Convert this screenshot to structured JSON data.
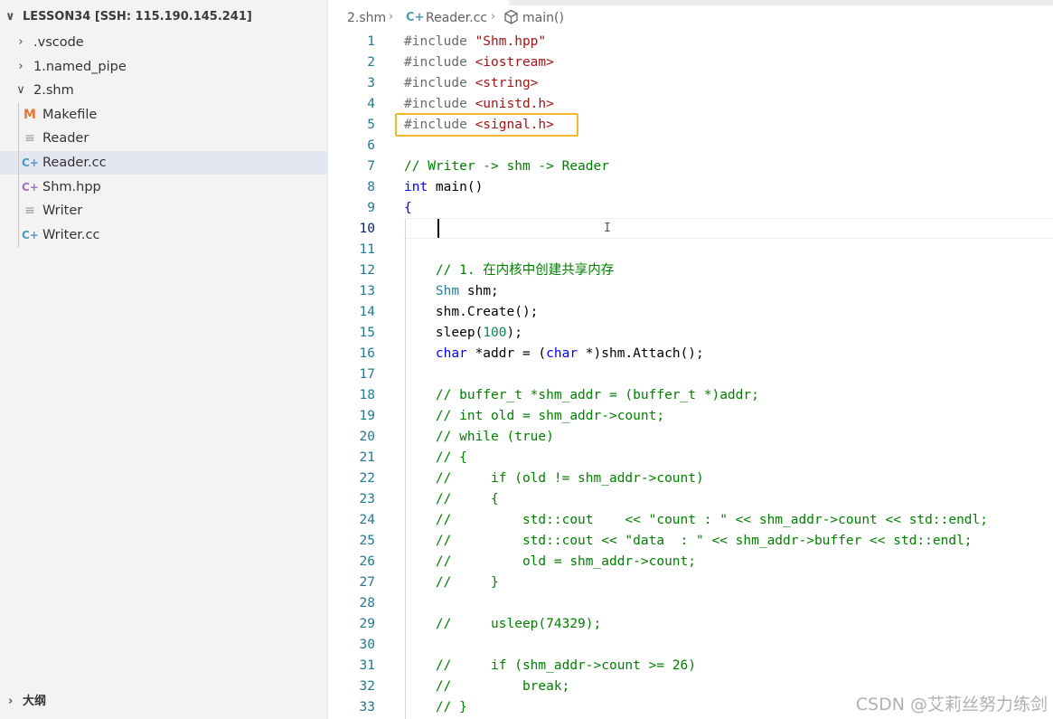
{
  "sidebar": {
    "root_label": "LESSON34 [SSH: 115.190.145.241]",
    "items": [
      {
        "label": ".vscode",
        "kind": "folder",
        "expanded": false
      },
      {
        "label": "1.named_pipe",
        "kind": "folder",
        "expanded": false
      },
      {
        "label": "2.shm",
        "kind": "folder",
        "expanded": true
      },
      {
        "label": "Makefile",
        "kind": "makefile",
        "icon": "makefile-icon",
        "icon_glyph": "M",
        "icon_color": "#e37933"
      },
      {
        "label": "Reader",
        "kind": "file",
        "icon": "plain-file-icon",
        "icon_glyph": "≡",
        "icon_color": "#9a9a9a"
      },
      {
        "label": "Reader.cc",
        "kind": "cpp",
        "icon": "cpp-file-icon",
        "icon_glyph": "C+",
        "icon_color": "#519aba",
        "selected": true
      },
      {
        "label": "Shm.hpp",
        "kind": "hpp",
        "icon": "hpp-file-icon",
        "icon_glyph": "C+",
        "icon_color": "#a074c4"
      },
      {
        "label": "Writer",
        "kind": "file",
        "icon": "plain-file-icon",
        "icon_glyph": "≡",
        "icon_color": "#9a9a9a"
      },
      {
        "label": "Writer.cc",
        "kind": "cpp",
        "icon": "cpp-file-icon",
        "icon_glyph": "C+",
        "icon_color": "#519aba"
      }
    ],
    "outline_label": "大纲"
  },
  "breadcrumb": {
    "folder": "2.shm",
    "file": "Reader.cc",
    "symbol": "main()"
  },
  "editor": {
    "line_numbers": [
      "1",
      "2",
      "3",
      "4",
      "5",
      "6",
      "7",
      "8",
      "9",
      "10",
      "11",
      "12",
      "13",
      "14",
      "15",
      "16",
      "17",
      "18",
      "19",
      "20",
      "21",
      "22",
      "23",
      "24",
      "25",
      "26",
      "27",
      "28",
      "29",
      "30",
      "31",
      "32",
      "33"
    ],
    "lines": [
      [
        {
          "t": "#include ",
          "c": "pre"
        },
        {
          "t": "\"Shm.hpp\"",
          "c": "str"
        }
      ],
      [
        {
          "t": "#include ",
          "c": "pre"
        },
        {
          "t": "<iostream>",
          "c": "str"
        }
      ],
      [
        {
          "t": "#include ",
          "c": "pre"
        },
        {
          "t": "<string>",
          "c": "str"
        }
      ],
      [
        {
          "t": "#include ",
          "c": "pre"
        },
        {
          "t": "<unistd.h>",
          "c": "str"
        }
      ],
      [
        {
          "t": "#include ",
          "c": "pre"
        },
        {
          "t": "<signal.h>",
          "c": "str"
        }
      ],
      [],
      [
        {
          "t": "// Writer -> shm -> Reader",
          "c": "com"
        }
      ],
      [
        {
          "t": "int",
          "c": "kw"
        },
        {
          "t": " main()",
          "c": "def"
        }
      ],
      [
        {
          "t": "{",
          "c": "kw"
        }
      ],
      [],
      [],
      [
        {
          "t": "    // 1. 在内核中创建共享内存",
          "c": "com"
        }
      ],
      [
        {
          "t": "    ",
          "c": "def"
        },
        {
          "t": "Shm",
          "c": "type"
        },
        {
          "t": " shm;",
          "c": "def"
        }
      ],
      [
        {
          "t": "    shm.Create();",
          "c": "def"
        }
      ],
      [
        {
          "t": "    sleep(",
          "c": "def"
        },
        {
          "t": "100",
          "c": "num"
        },
        {
          "t": ");",
          "c": "def"
        }
      ],
      [
        {
          "t": "    ",
          "c": "def"
        },
        {
          "t": "char",
          "c": "kw"
        },
        {
          "t": " *addr = (",
          "c": "def"
        },
        {
          "t": "char",
          "c": "kw"
        },
        {
          "t": " *)shm.Attach();",
          "c": "def"
        }
      ],
      [],
      [
        {
          "t": "    // buffer_t *shm_addr = (buffer_t *)addr;",
          "c": "com"
        }
      ],
      [
        {
          "t": "    // int old = shm_addr->count;",
          "c": "com"
        }
      ],
      [
        {
          "t": "    // while (true)",
          "c": "com"
        }
      ],
      [
        {
          "t": "    // {",
          "c": "com"
        }
      ],
      [
        {
          "t": "    //     if (old != shm_addr->count)",
          "c": "com"
        }
      ],
      [
        {
          "t": "    //     {",
          "c": "com"
        }
      ],
      [
        {
          "t": "    //         std::cout    << \"count : \" << shm_addr->count << std::endl;",
          "c": "com"
        }
      ],
      [
        {
          "t": "    //         std::cout << \"data  : \" << shm_addr->buffer << std::endl;",
          "c": "com"
        }
      ],
      [
        {
          "t": "    //         old = shm_addr->count;",
          "c": "com"
        }
      ],
      [
        {
          "t": "    //     }",
          "c": "com"
        }
      ],
      [],
      [
        {
          "t": "    //     usleep(74329);",
          "c": "com"
        }
      ],
      [],
      [
        {
          "t": "    //     if (shm_addr->count >= 26)",
          "c": "com"
        }
      ],
      [
        {
          "t": "    //         break;",
          "c": "com"
        }
      ],
      [
        {
          "t": "    // }",
          "c": "com"
        }
      ]
    ],
    "cursor_line": 10,
    "highlighted_line": 5
  },
  "watermark": "CSDN @艾莉丝努力练剑"
}
